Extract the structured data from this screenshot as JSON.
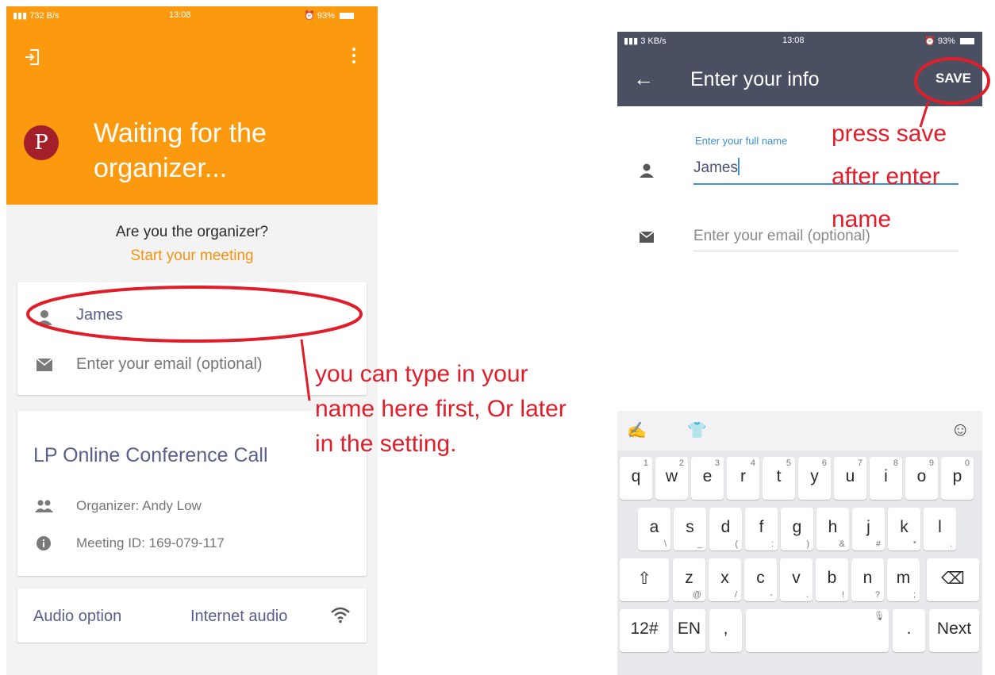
{
  "left_screen": {
    "status_bar": {
      "network": "732 B/s",
      "time": "13:08",
      "battery": "93%"
    },
    "title": "Waiting for the organizer...",
    "organizer_question": "Are you the organizer?",
    "start_meeting_link": "Start your meeting",
    "user_card": {
      "name": "James",
      "email_placeholder": "Enter your email (optional)"
    },
    "meeting_card": {
      "title": "LP Online Conference Call",
      "organizer": "Organizer: Andy Low",
      "meeting_id": "Meeting ID: 169-079-117"
    },
    "audio_card": {
      "label": "Audio option",
      "value": "Internet audio"
    },
    "logo_letter": "P",
    "accent_color": "#fb9a0e"
  },
  "right_screen": {
    "status_bar": {
      "network": "3 KB/s",
      "time": "13:08",
      "battery": "93%"
    },
    "toolbar": {
      "title": "Enter your info",
      "save_label": "SAVE"
    },
    "fullname_label": "Enter your full name",
    "fullname_value": "James",
    "email_placeholder": "Enter your email (optional)",
    "keyboard": {
      "row1": [
        [
          "q",
          "1"
        ],
        [
          "w",
          "2"
        ],
        [
          "e",
          "3"
        ],
        [
          "r",
          "4"
        ],
        [
          "t",
          "5"
        ],
        [
          "y",
          "6"
        ],
        [
          "u",
          "7"
        ],
        [
          "i",
          "8"
        ],
        [
          "o",
          "9"
        ],
        [
          "p",
          "0"
        ]
      ],
      "row2": [
        [
          "a",
          "\\"
        ],
        [
          "s",
          "_"
        ],
        [
          "d",
          "("
        ],
        [
          "f",
          ":"
        ],
        [
          "g",
          ")"
        ],
        [
          "h",
          "&"
        ],
        [
          "j",
          "#"
        ],
        [
          "k",
          "*"
        ],
        [
          "l",
          "."
        ]
      ],
      "row3": [
        [
          "z",
          "@"
        ],
        [
          "x",
          "/"
        ],
        [
          "c",
          "-"
        ],
        [
          "v",
          "."
        ],
        [
          "b",
          "!"
        ],
        [
          "n",
          "?"
        ],
        [
          "m",
          ";"
        ]
      ],
      "symbols_key": "12#",
      "lang_key": "EN",
      "comma_key": ",",
      "period_key": ".",
      "next_key": "Next"
    }
  },
  "annotations": {
    "name_note": [
      "you can type in your",
      "name here first, Or later",
      "in the setting."
    ],
    "save_note": [
      "press save",
      "after enter",
      "name"
    ],
    "color": "#e11d2a"
  }
}
